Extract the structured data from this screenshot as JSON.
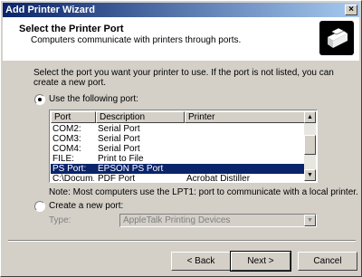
{
  "window": {
    "title": "Add Printer Wizard",
    "close_glyph": "×"
  },
  "header": {
    "title": "Select the Printer Port",
    "subtitle": "Computers communicate with printers through ports.",
    "icon": "printer-port-icon"
  },
  "intro": "Select the port you want your printer to use.  If the port is not listed, you can create a new port.",
  "use_port": {
    "label": "Use the following port:",
    "selected": true
  },
  "port_list": {
    "columns": [
      "Port",
      "Description",
      "Printer"
    ],
    "rows": [
      {
        "port": "COM2:",
        "description": "Serial Port",
        "printer": "",
        "selected": false
      },
      {
        "port": "COM3:",
        "description": "Serial Port",
        "printer": "",
        "selected": false
      },
      {
        "port": "COM4:",
        "description": "Serial Port",
        "printer": "",
        "selected": false
      },
      {
        "port": "FILE:",
        "description": "Print to File",
        "printer": "",
        "selected": false
      },
      {
        "port": "PS Port:",
        "description": "EPSON PS Port",
        "printer": "",
        "selected": true
      },
      {
        "port": "C:\\Docum...",
        "description": "PDF Port",
        "printer": "Acrobat Distiller",
        "selected": false
      }
    ]
  },
  "note": "Note: Most computers use the LPT1: port to communicate with a local printer.",
  "create_port": {
    "label": "Create a new port:",
    "selected": false,
    "type_label": "Type:",
    "type_value": "AppleTalk Printing Devices"
  },
  "buttons": {
    "back": "< Back",
    "next": "Next >",
    "cancel": "Cancel"
  }
}
